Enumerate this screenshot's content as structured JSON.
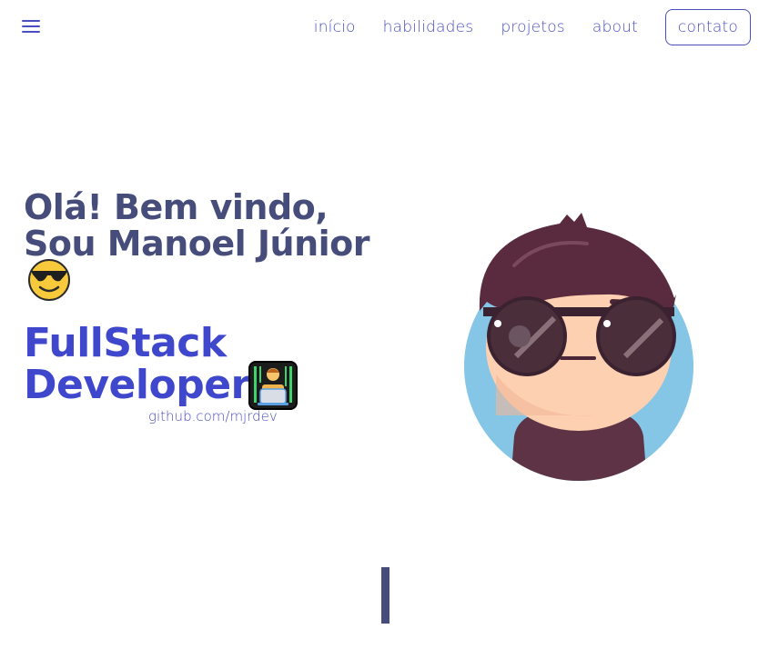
{
  "nav": {
    "menu_icon": "hamburger-menu-icon",
    "items": [
      "início",
      "habilidades",
      "projetos",
      "about"
    ],
    "contact_label": "contato"
  },
  "hero": {
    "greeting_line1": "Olá! Bem vindo,",
    "greeting_line2": "Sou Manoel Júnior",
    "greeting_emoji": "smiling-face-with-sunglasses-icon",
    "role_line1": "FullStack",
    "role_line2": "Developer",
    "role_emoji": "technologist-icon",
    "github_link": "github.com/mjrdev",
    "avatar": "cartoon-avatar-with-sunglasses"
  },
  "colors": {
    "accent": "#4a4fbf",
    "heading": "#464d7a",
    "role": "#3f47cc",
    "avatar_bg": "#85c5e6",
    "hair": "#5a2a3f",
    "shirt": "#5e3346",
    "skin": "#fdd0b1"
  }
}
